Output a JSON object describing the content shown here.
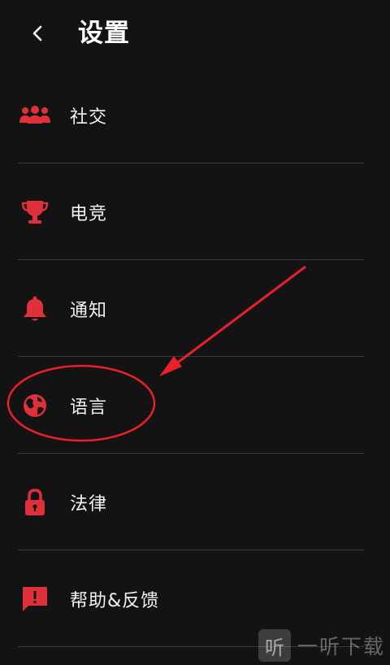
{
  "header": {
    "title": "设置",
    "back_icon": "chevron-left-icon"
  },
  "menu": {
    "items": [
      {
        "label": "社交",
        "icon": "people-group-icon"
      },
      {
        "label": "电竞",
        "icon": "trophy-icon"
      },
      {
        "label": "通知",
        "icon": "bell-icon"
      },
      {
        "label": "语言",
        "icon": "globe-icon"
      },
      {
        "label": "法律",
        "icon": "lock-icon"
      },
      {
        "label": "帮助&反馈",
        "icon": "feedback-exclamation-icon"
      }
    ]
  },
  "colors": {
    "background": "#141314",
    "accent": "#e0303a",
    "text": "#f2f2f2",
    "divider": "#3a3a3a",
    "annotation": "#e8202a"
  },
  "watermark": {
    "glyph": "听",
    "text": "一听下载"
  }
}
